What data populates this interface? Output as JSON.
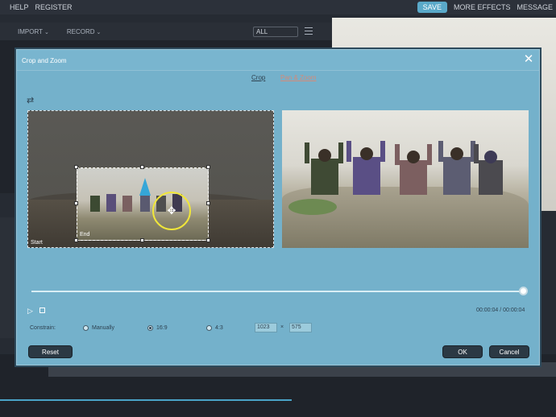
{
  "menu": {
    "items": [
      "HELP",
      "REGISTER"
    ],
    "save_label": "SAVE",
    "more_effects_label": "MORE EFFECTS",
    "message_label": "MESSAGE"
  },
  "toolbar": {
    "import_label": "IMPORT",
    "record_label": "RECORD",
    "filter_value": "ALL"
  },
  "dialog": {
    "title": "Crop and Zoom",
    "tabs": [
      {
        "label": "Crop",
        "active": true
      },
      {
        "label": "Pan & Zoom",
        "active": false
      }
    ],
    "source": {
      "start_label": "Start",
      "end_label": "End"
    },
    "playback": {
      "timecode": "00:00:04 / 00:00:04",
      "progress": 1.0
    },
    "constrain": {
      "label": "Constrain:",
      "options": [
        "Manually",
        "16:9",
        "4:3"
      ],
      "selected": "16:9",
      "width": "1023",
      "height": "575",
      "separator": "×"
    },
    "buttons": {
      "reset": "Reset",
      "ok": "OK",
      "cancel": "Cancel"
    }
  },
  "colors": {
    "dialog_bg": "#74b1cb",
    "accent": "#5aa9c9",
    "focus_ring": "#f0e63a",
    "pan_zoom_tab": "#d58a78"
  }
}
